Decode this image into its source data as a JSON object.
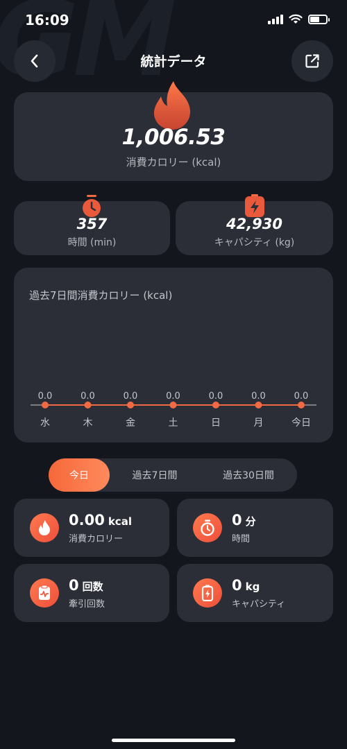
{
  "status_bar": {
    "time": "16:09"
  },
  "header": {
    "title": "統計データ"
  },
  "summary": {
    "calories_value": "1,006.53",
    "calories_label": "消費カロリー (kcal)"
  },
  "time_stat": {
    "value": "357",
    "label": "時間 (min)"
  },
  "capacity_stat": {
    "value": "42,930",
    "label": "キャパシティ (kg)"
  },
  "chart_data": {
    "type": "line",
    "title": "過去7日間消費カロリー (kcal)",
    "categories": [
      "水",
      "木",
      "金",
      "土",
      "日",
      "月",
      "今日"
    ],
    "values": [
      0.0,
      0.0,
      0.0,
      0.0,
      0.0,
      0.0,
      0.0
    ],
    "value_labels": [
      "0.0",
      "0.0",
      "0.0",
      "0.0",
      "0.0",
      "0.0",
      "0.0"
    ],
    "ylim": [
      0,
      1
    ],
    "grid": false,
    "color": "#f26a43"
  },
  "tabs": [
    {
      "label": "今日",
      "active": true
    },
    {
      "label": "過去7日間",
      "active": false
    },
    {
      "label": "過去30日間",
      "active": false
    }
  ],
  "metrics": {
    "calories": {
      "value": "0.00",
      "unit": "kcal",
      "label": "消費カロリー",
      "icon": "flame-icon"
    },
    "time": {
      "value": "0",
      "unit": "分",
      "label": "時間",
      "icon": "stopwatch-icon"
    },
    "pulls": {
      "value": "0",
      "unit": "回数",
      "label": "牽引回数",
      "icon": "clipboard-pulse-icon"
    },
    "capacity": {
      "value": "0",
      "unit": "kg",
      "label": "キャパシティ",
      "icon": "battery-bolt-icon"
    }
  },
  "colors": {
    "accent": "#f26a43",
    "background": "#13161d",
    "card": "#2b2e37"
  }
}
